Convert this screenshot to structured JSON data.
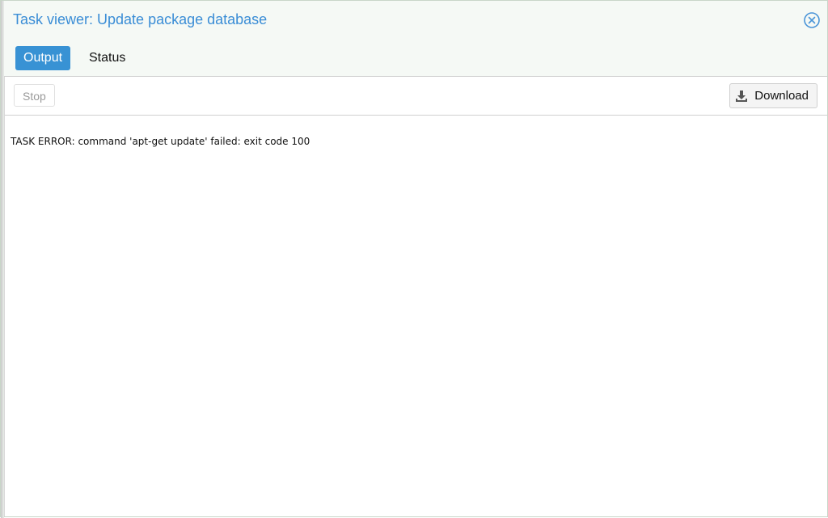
{
  "window": {
    "title": "Task viewer: Update package database"
  },
  "tabs": [
    {
      "label": "Output",
      "active": true
    },
    {
      "label": "Status",
      "active": false
    }
  ],
  "toolbar": {
    "stop_label": "Stop",
    "download_label": "Download"
  },
  "output": {
    "lines": [
      "TASK ERROR: command 'apt-get update' failed: exit code 100"
    ]
  },
  "icons": {
    "close": "close-circle-icon",
    "download": "download-icon"
  },
  "colors": {
    "accent": "#3892d4",
    "title": "#3a8dd6"
  }
}
